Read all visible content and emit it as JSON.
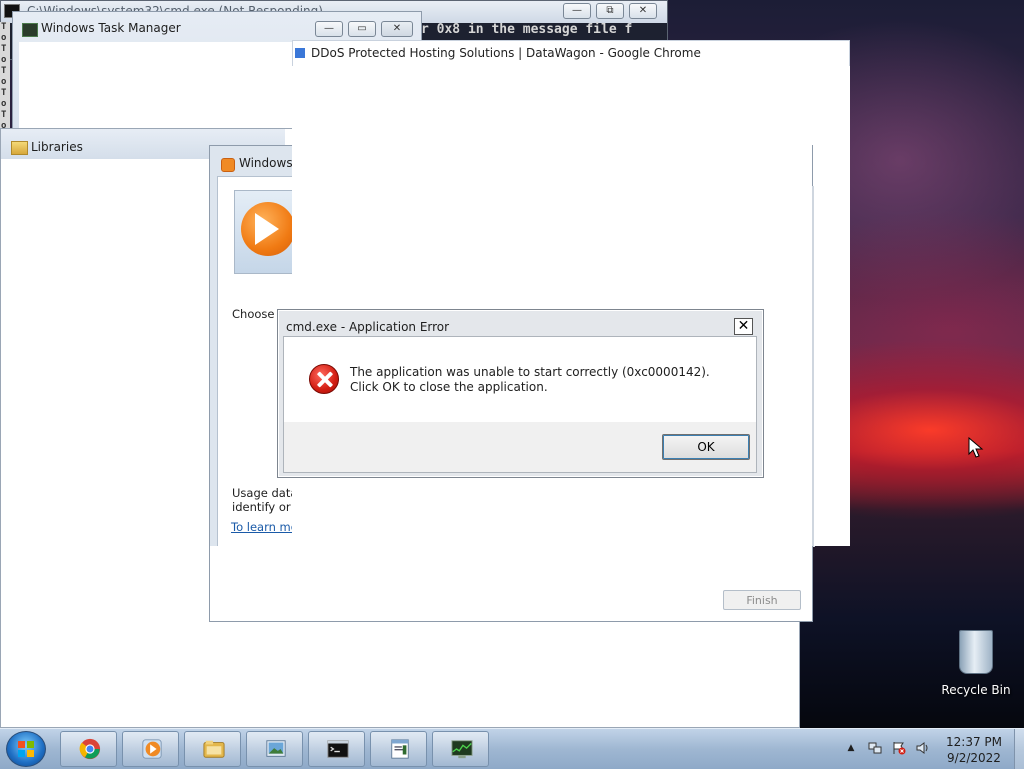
{
  "windows": {
    "cmd": {
      "title": "C:\\Windows\\system32\\cmd.exe (Not Responding)",
      "visible_text": "r 0x8 in the message file f",
      "side_chars": [
        "T",
        "o",
        "T",
        "o",
        "T",
        "o",
        "T",
        "o",
        "T",
        "o"
      ],
      "caption": {
        "minimize": "—",
        "restore": "⧉",
        "close": "✕"
      }
    },
    "task_manager": {
      "title": "Windows Task Manager",
      "caption": {
        "minimize": "—",
        "restore": "▭",
        "close": "✕"
      }
    },
    "chrome": {
      "title": "DDoS Protected Hosting Solutions | DataWagon - Google Chrome"
    },
    "libraries": {
      "title": "Libraries"
    },
    "wmp_setup": {
      "title": "Windows",
      "choose_text": "Choose t",
      "usage_line1": "Usage data w",
      "usage_line2": "identify or co",
      "learn_more": "To learn more",
      "finish": "Finish"
    },
    "error_dialog": {
      "title": "cmd.exe - Application Error",
      "close": "✕",
      "message": "The application was unable to start correctly (0xc0000142). Click OK to close the application.",
      "ok": "OK"
    }
  },
  "desktop": {
    "recycle_bin": "Recycle Bin"
  },
  "taskbar": {
    "pinned": [
      {
        "name": "chrome-icon"
      },
      {
        "name": "media-player-icon"
      },
      {
        "name": "explorer-folder-icon"
      },
      {
        "name": "photo-viewer-icon"
      },
      {
        "name": "cmd-icon"
      },
      {
        "name": "notepad-icon"
      },
      {
        "name": "task-manager-icon"
      }
    ],
    "tray": {
      "show_hidden": "▲",
      "time": "12:37 PM",
      "date": "9/2/2022"
    }
  }
}
